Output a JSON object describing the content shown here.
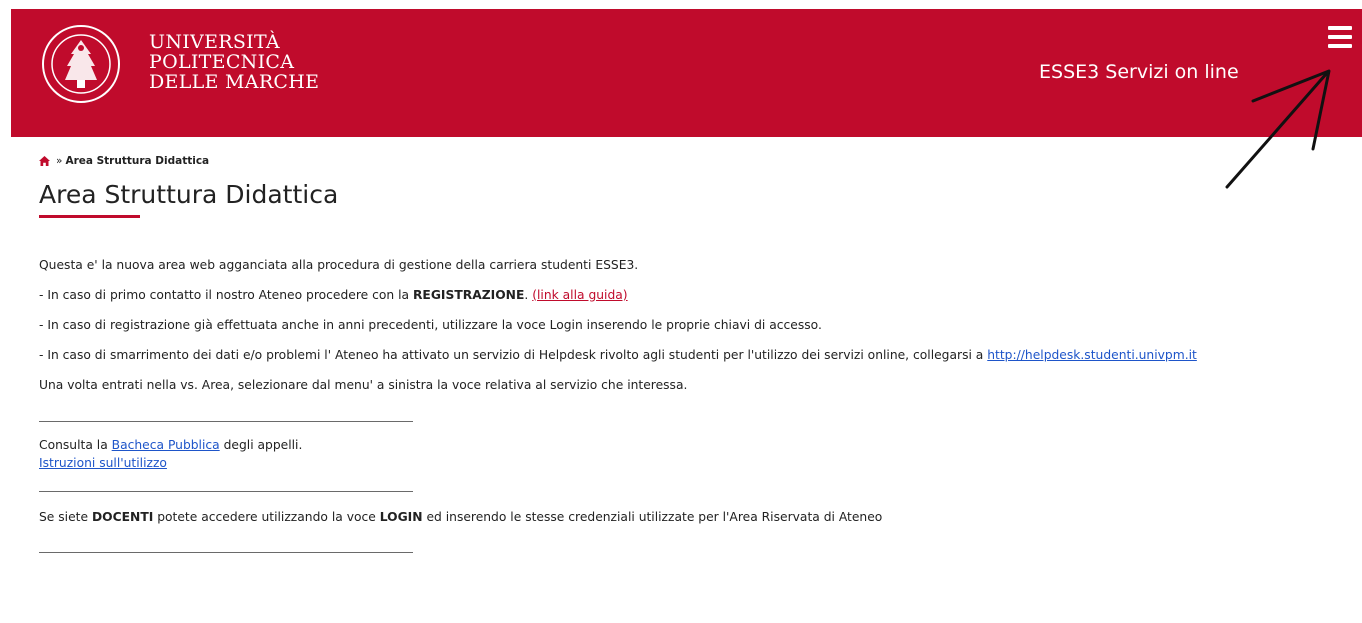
{
  "header": {
    "university_name": [
      "UNIVERSITÀ",
      "POLITECNICA",
      "DELLE MARCHE"
    ],
    "site_title": "ESSE3 Servizi on line",
    "brand_color": "#c00b2c",
    "menu_icon": "hamburger-menu-icon"
  },
  "breadcrumb": {
    "home_icon": "home-icon",
    "separator": "»",
    "current": "Area Struttura Didattica"
  },
  "page": {
    "title": "Area Struttura Didattica",
    "intro": "Questa e' la nuova area web agganciata alla procedura di gestione della carriera studenti ESSE3.",
    "first_contact": {
      "prefix": "- In caso di primo contatto il nostro Ateneo procedere con la ",
      "bold": "REGISTRAZIONE",
      "suffix": ". ",
      "link": "(link alla guida)"
    },
    "registered": "- In caso di registrazione già effettuata anche in anni precedenti, utilizzare la voce Login inserendo le proprie chiavi di accesso.",
    "helpdesk": {
      "prefix": "- In caso di smarrimento dei dati e/o problemi l' Ateneo ha attivato un servizio di Helpdesk rivolto agli studenti per l'utilizzo dei servizi online, collegarsi a ",
      "link": "http://helpdesk.studenti.univpm.it"
    },
    "menu_hint": "Una volta entrati nella vs. Area, selezionare dal menu' a sinistra la voce relativa al servizio che interessa.",
    "bacheca": {
      "prefix": "Consulta la ",
      "link": "Bacheca Pubblica",
      "suffix": " degli appelli."
    },
    "istruzioni_link": "Istruzioni sull'utilizzo",
    "docenti": {
      "p1": "Se siete ",
      "b1": "DOCENTI",
      "p2": " potete accedere utilizzando la voce ",
      "b2": "LOGIN",
      "p3": " ed inserendo le stesse credenziali utilizzate per l'Area Riservata di Ateneo"
    }
  }
}
